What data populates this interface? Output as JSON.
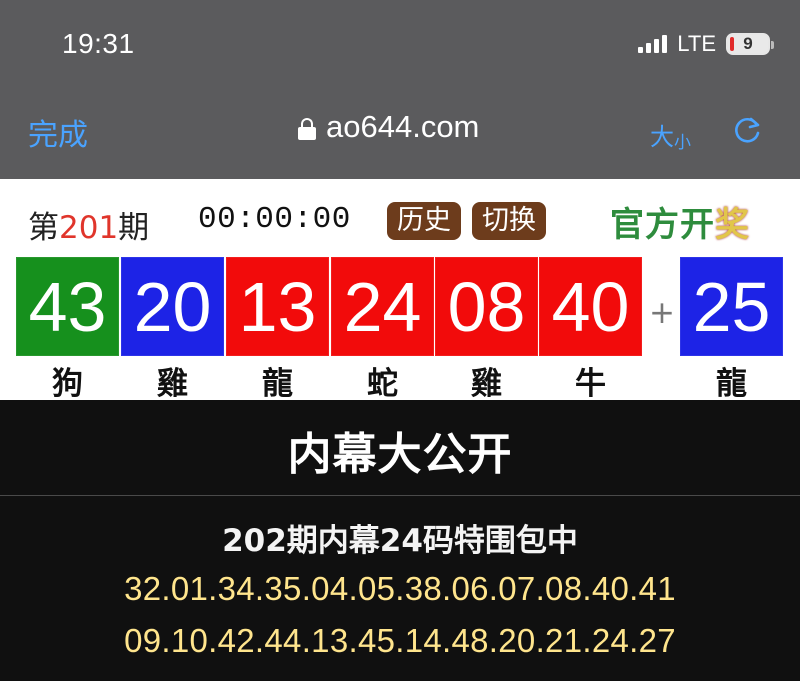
{
  "status_bar": {
    "time": "19:31",
    "network": "LTE",
    "battery": "9"
  },
  "browser": {
    "done_label": "完成",
    "url": "ao644.com",
    "text_size_large": "大",
    "text_size_small": "小",
    "icons": [
      "lock-icon",
      "reload-icon"
    ]
  },
  "lottery": {
    "period_prefix": "第",
    "period_number": "201",
    "period_suffix": "期",
    "countdown": "00:00:00",
    "history_label": "历史",
    "switch_label": "切换",
    "official_label_prefix": "官方开",
    "official_label_suffix": "奖",
    "plus_sign": "+",
    "balls": [
      {
        "number": "43",
        "zodiac": "狗",
        "color": "#16901d"
      },
      {
        "number": "20",
        "zodiac": "雞",
        "color": "#1d23e6"
      },
      {
        "number": "13",
        "zodiac": "龍",
        "color": "#f20b0b"
      },
      {
        "number": "24",
        "zodiac": "蛇",
        "color": "#f20b0b"
      },
      {
        "number": "08",
        "zodiac": "雞",
        "color": "#f20b0b"
      },
      {
        "number": "40",
        "zodiac": "牛",
        "color": "#f20b0b"
      },
      {
        "number": "25",
        "zodiac": "龍",
        "color": "#1d23e6"
      }
    ]
  },
  "info": {
    "headline": "内幕大公开",
    "subtitle": "202期内幕24码特围包中",
    "line1": "32.01.34.35.04.05.38.06.07.08.40.41",
    "line2": "09.10.42.44.13.45.14.48.20.21.24.27"
  }
}
